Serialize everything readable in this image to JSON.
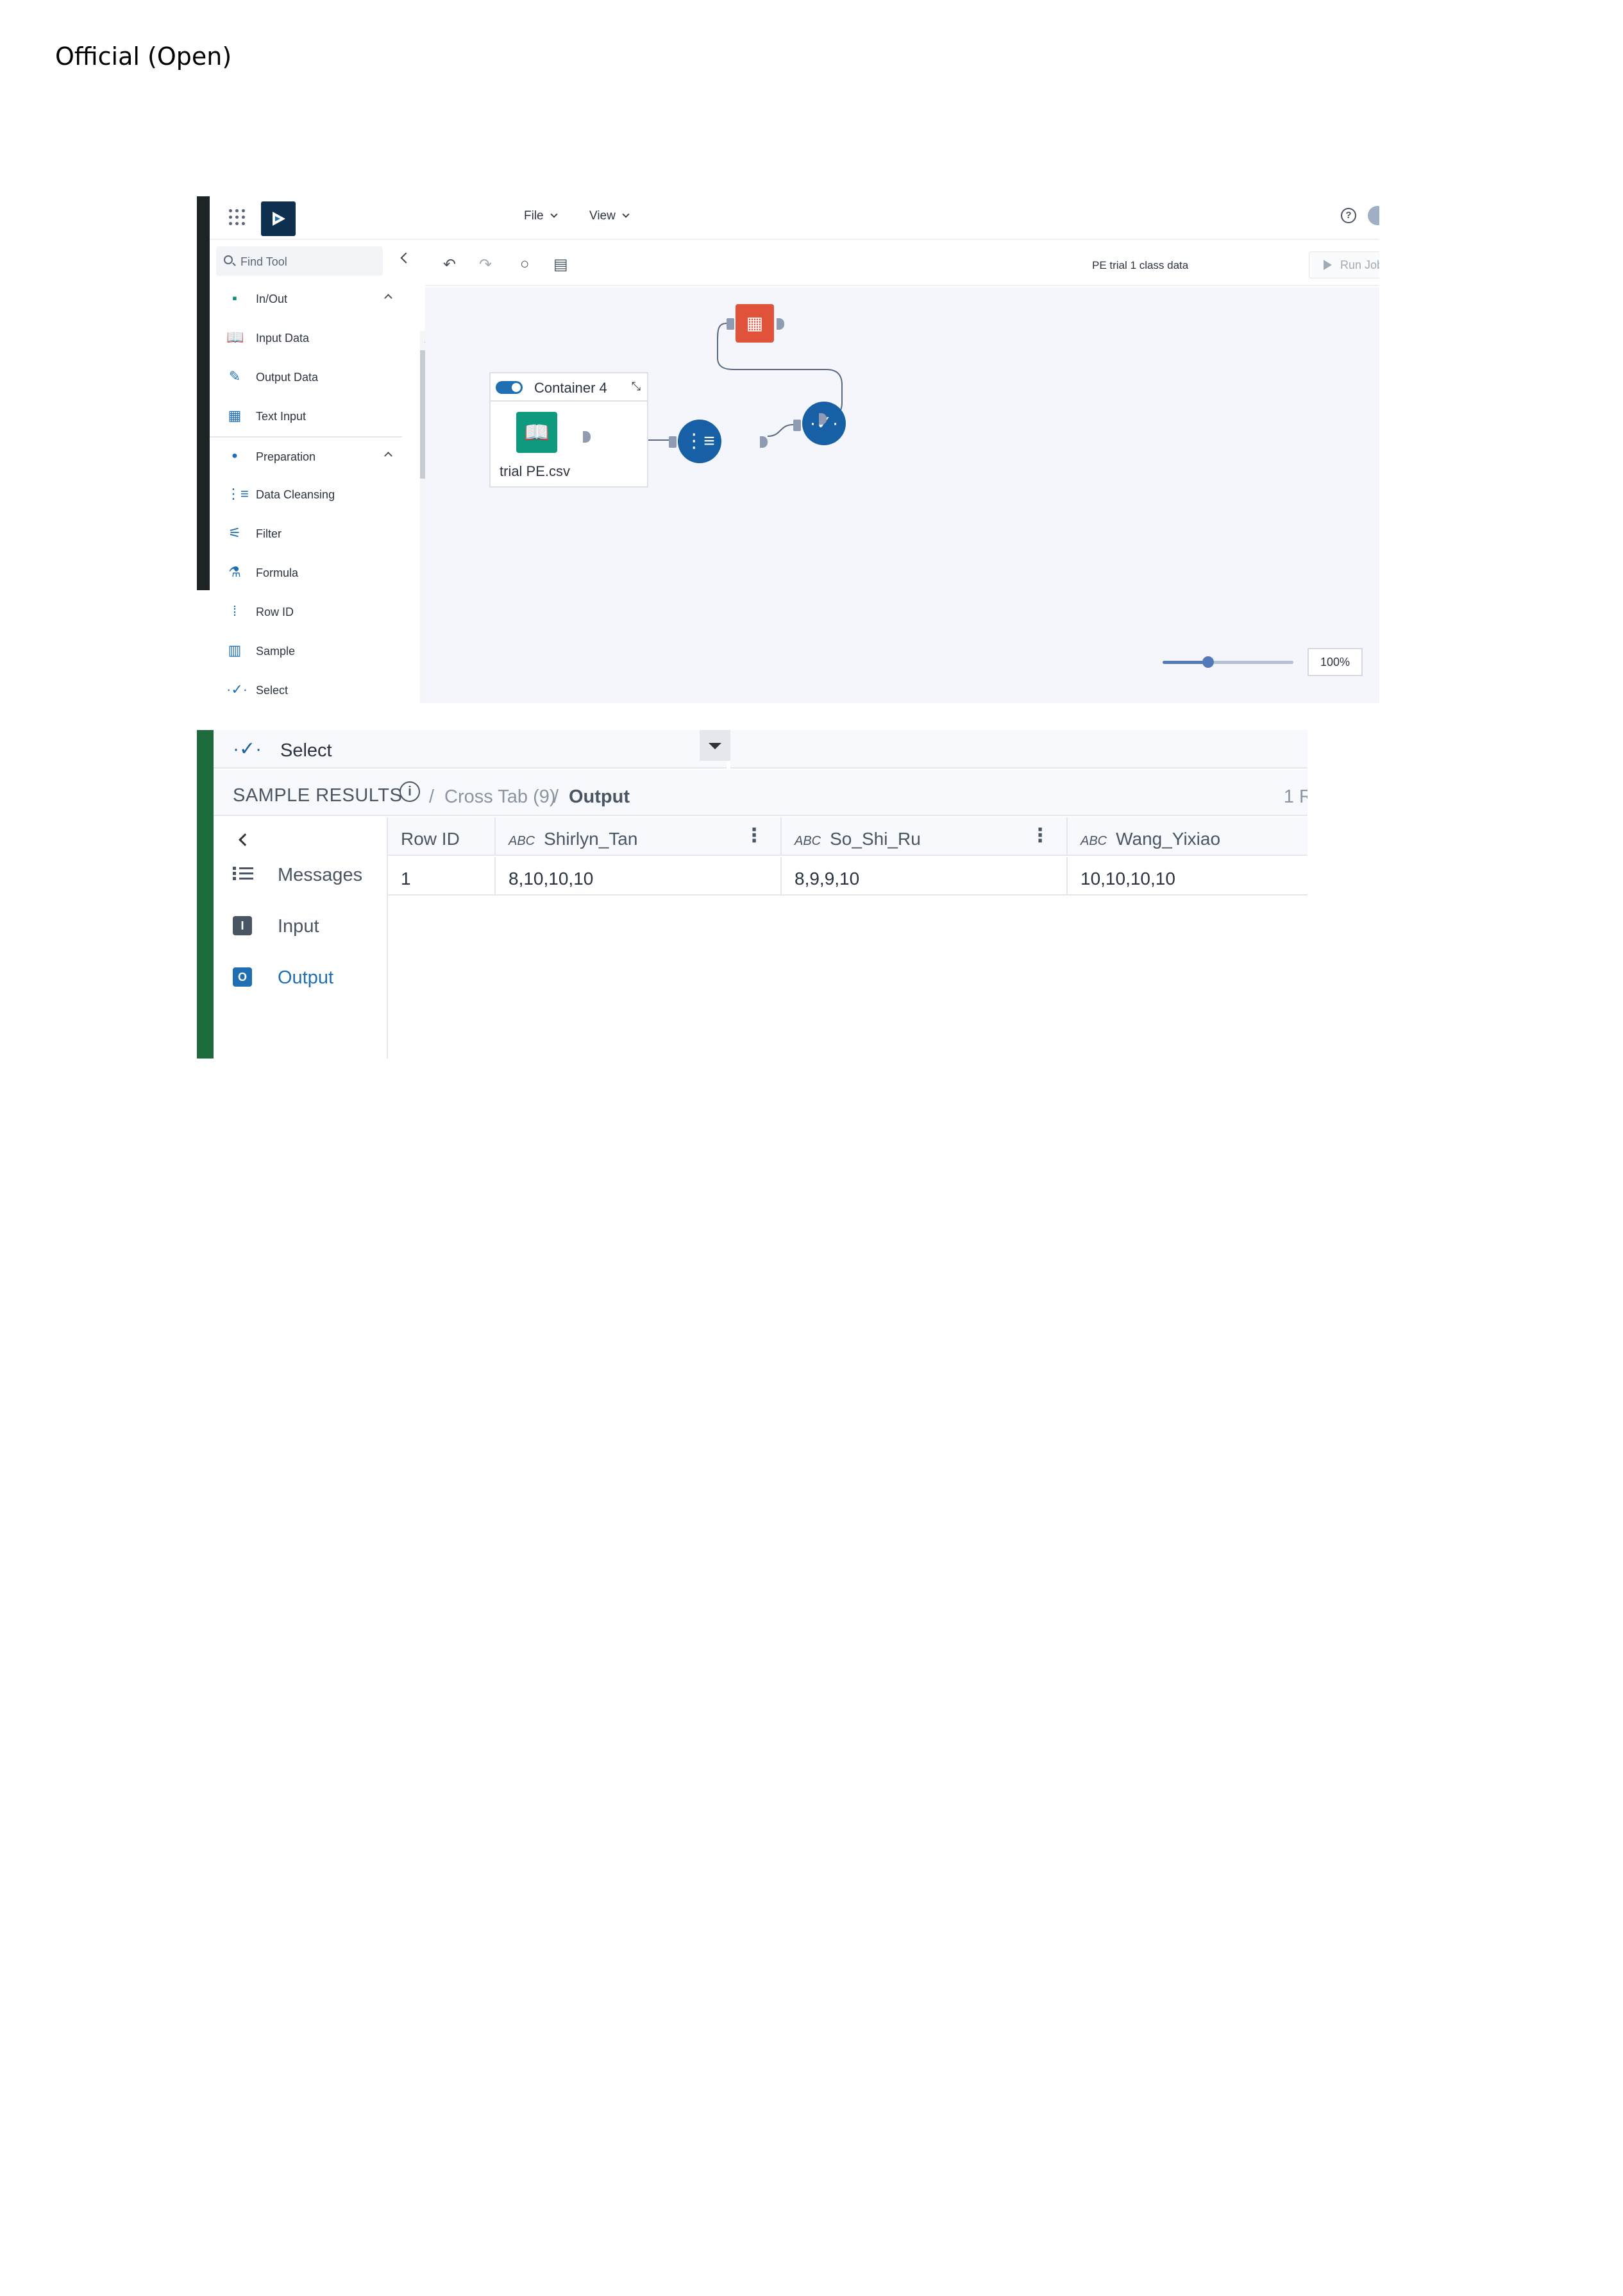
{
  "document": {
    "label": "Official (Open)"
  },
  "designer": {
    "menus": [
      "File",
      "View"
    ],
    "find_tool_placeholder": "Find Tool",
    "workflow_title": "PE trial 1 class data",
    "run_job": "Run Job",
    "tools": [
      {
        "label": "In/Out",
        "icon": "folder-icon",
        "category": true
      },
      {
        "label": "Input Data",
        "icon": "book-icon"
      },
      {
        "label": "Output Data",
        "icon": "output-icon"
      },
      {
        "label": "Text Input",
        "icon": "text-input-icon"
      },
      {
        "label": "Preparation",
        "icon": "dot-icon",
        "category": true
      },
      {
        "label": "Data Cleansing",
        "icon": "broom-icon"
      },
      {
        "label": "Filter",
        "icon": "filter-icon"
      },
      {
        "label": "Formula",
        "icon": "flask-icon"
      },
      {
        "label": "Row ID",
        "icon": "row-id-icon"
      },
      {
        "label": "Sample",
        "icon": "sample-icon"
      },
      {
        "label": "Select",
        "icon": "select-icon"
      }
    ],
    "canvas": {
      "container_title": "Container 4",
      "input_node_label": "trial PE.csv",
      "zoom_level": "100%",
      "zoom_fraction": 0.35
    },
    "colors": {
      "brand": "#0f2f4f",
      "input_node": "#0f9a7f",
      "tool_node": "#1860a6",
      "browse_node": "#e0533a"
    }
  },
  "results": {
    "tool_name": "Select",
    "title": "SAMPLE RESULTS",
    "breadcrumb": [
      "Cross Tab (9)",
      "Output"
    ],
    "row_count": "1 R",
    "nav": [
      {
        "label": "Messages",
        "icon": "list-icon"
      },
      {
        "label": "Input",
        "icon": "input-badge-icon",
        "badge": "I"
      },
      {
        "label": "Output",
        "icon": "output-badge-icon",
        "badge": "O",
        "active": true
      }
    ],
    "columns": [
      "Row ID",
      "Shirlyn_Tan",
      "So_Shi_Ru",
      "Wang_Yixiao"
    ],
    "rows": [
      [
        "1",
        "8,10,10,10",
        "8,9,9,10",
        "10,10,10,10"
      ]
    ],
    "type_badge": "ABC"
  }
}
